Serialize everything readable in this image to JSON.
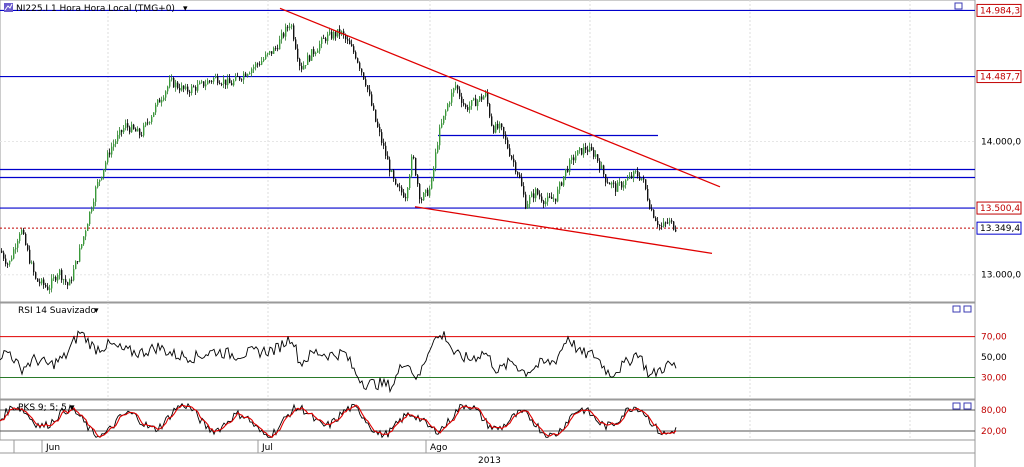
{
  "chart_data": {
    "type": "candlestick",
    "symbol": "NI225.I",
    "timeframe": "1 Hora",
    "timezone": "Hora Local (TMG+0)",
    "title": "NI225.I 1 Hora Hora Local (TMG+0)",
    "price_axis": {
      "range": [
        12810,
        15040
      ],
      "ticks": [
        "14.000,0",
        "13.000,0"
      ],
      "tick_values": [
        14000,
        13000
      ]
    },
    "horizontal_levels": [
      {
        "label": "14.984,3",
        "value": 14984.3,
        "color": "#0000cc"
      },
      {
        "label": "14.487,7",
        "value": 14487.7,
        "color": "#0000cc"
      },
      {
        "value": 14045,
        "color": "#0000cc",
        "partial": true
      },
      {
        "value": 13790,
        "color": "#0000cc"
      },
      {
        "value": 13730,
        "color": "#0000cc"
      },
      {
        "label": "13.500,4",
        "value": 13500.4,
        "color": "#0000cc"
      }
    ],
    "last_price": {
      "label": "13.349,4",
      "value": 13349.4,
      "color": "#c00000",
      "style": "dotted"
    },
    "trendlines": [
      {
        "name": "resistance",
        "color": "#e00000",
        "from": {
          "bar": 280,
          "value": 15000
        },
        "to": {
          "bar": 720,
          "value": 13660
        }
      },
      {
        "name": "support",
        "color": "#e00000",
        "from": {
          "bar": 415,
          "value": 13510
        },
        "to": {
          "bar": 712,
          "value": 13160
        }
      }
    ],
    "close_anchors": [
      [
        0,
        13180
      ],
      [
        8,
        13070
      ],
      [
        20,
        13350
      ],
      [
        35,
        12960
      ],
      [
        48,
        12900
      ],
      [
        58,
        13030
      ],
      [
        68,
        12910
      ],
      [
        80,
        13200
      ],
      [
        95,
        13640
      ],
      [
        110,
        13950
      ],
      [
        125,
        14120
      ],
      [
        140,
        14050
      ],
      [
        158,
        14300
      ],
      [
        170,
        14450
      ],
      [
        185,
        14380
      ],
      [
        200,
        14420
      ],
      [
        215,
        14480
      ],
      [
        230,
        14430
      ],
      [
        245,
        14520
      ],
      [
        260,
        14600
      ],
      [
        275,
        14700
      ],
      [
        290,
        14900
      ],
      [
        300,
        14550
      ],
      [
        310,
        14650
      ],
      [
        325,
        14780
      ],
      [
        340,
        14820
      ],
      [
        355,
        14650
      ],
      [
        365,
        14450
      ],
      [
        375,
        14150
      ],
      [
        385,
        13900
      ],
      [
        395,
        13650
      ],
      [
        405,
        13600
      ],
      [
        412,
        13900
      ],
      [
        420,
        13560
      ],
      [
        430,
        13650
      ],
      [
        438,
        14050
      ],
      [
        448,
        14300
      ],
      [
        455,
        14420
      ],
      [
        465,
        14250
      ],
      [
        475,
        14300
      ],
      [
        485,
        14350
      ],
      [
        492,
        14100
      ],
      [
        500,
        14100
      ],
      [
        510,
        13900
      ],
      [
        518,
        13750
      ],
      [
        525,
        13530
      ],
      [
        535,
        13620
      ],
      [
        545,
        13550
      ],
      [
        555,
        13580
      ],
      [
        565,
        13780
      ],
      [
        575,
        13900
      ],
      [
        585,
        13950
      ],
      [
        595,
        13900
      ],
      [
        605,
        13720
      ],
      [
        615,
        13650
      ],
      [
        625,
        13700
      ],
      [
        635,
        13760
      ],
      [
        642,
        13720
      ],
      [
        650,
        13500
      ],
      [
        660,
        13350
      ],
      [
        668,
        13400
      ],
      [
        676,
        13349
      ]
    ],
    "rsi": {
      "name": "RSI 14 Suavizado",
      "range": [
        10,
        100
      ],
      "levels": [
        {
          "label": "70,00",
          "value": 70
        },
        {
          "label": "30,00",
          "value": 30
        }
      ],
      "tick": "50,00",
      "anchors": [
        [
          0,
          52
        ],
        [
          10,
          55
        ],
        [
          20,
          38
        ],
        [
          35,
          48
        ],
        [
          50,
          42
        ],
        [
          65,
          50
        ],
        [
          80,
          75
        ],
        [
          95,
          58
        ],
        [
          110,
          62
        ],
        [
          125,
          56
        ],
        [
          140,
          54
        ],
        [
          158,
          60
        ],
        [
          175,
          52
        ],
        [
          195,
          50
        ],
        [
          215,
          56
        ],
        [
          235,
          52
        ],
        [
          255,
          55
        ],
        [
          275,
          57
        ],
        [
          292,
          70
        ],
        [
          300,
          44
        ],
        [
          315,
          55
        ],
        [
          330,
          52
        ],
        [
          345,
          54
        ],
        [
          355,
          35
        ],
        [
          365,
          24
        ],
        [
          380,
          24
        ],
        [
          392,
          22
        ],
        [
          405,
          48
        ],
        [
          418,
          28
        ],
        [
          432,
          66
        ],
        [
          445,
          72
        ],
        [
          455,
          52
        ],
        [
          470,
          48
        ],
        [
          485,
          55
        ],
        [
          498,
          36
        ],
        [
          512,
          46
        ],
        [
          525,
          35
        ],
        [
          540,
          43
        ],
        [
          555,
          46
        ],
        [
          568,
          70
        ],
        [
          580,
          54
        ],
        [
          595,
          52
        ],
        [
          610,
          33
        ],
        [
          625,
          43
        ],
        [
          638,
          55
        ],
        [
          650,
          31
        ],
        [
          660,
          38
        ],
        [
          670,
          43
        ],
        [
          676,
          40
        ]
      ]
    },
    "stoch": {
      "name": "PKS 9; 5; 5",
      "range": [
        0,
        100
      ],
      "levels": [
        {
          "label": "80,00",
          "value": 80
        },
        {
          "label": "20,00",
          "value": 20
        }
      ],
      "series": [
        {
          "color": "#000000"
        },
        {
          "color": "#e00000"
        }
      ]
    },
    "time_axis": {
      "months": [
        "Jun",
        "Jul",
        "Ago"
      ],
      "year": "2013"
    },
    "grid": true
  }
}
